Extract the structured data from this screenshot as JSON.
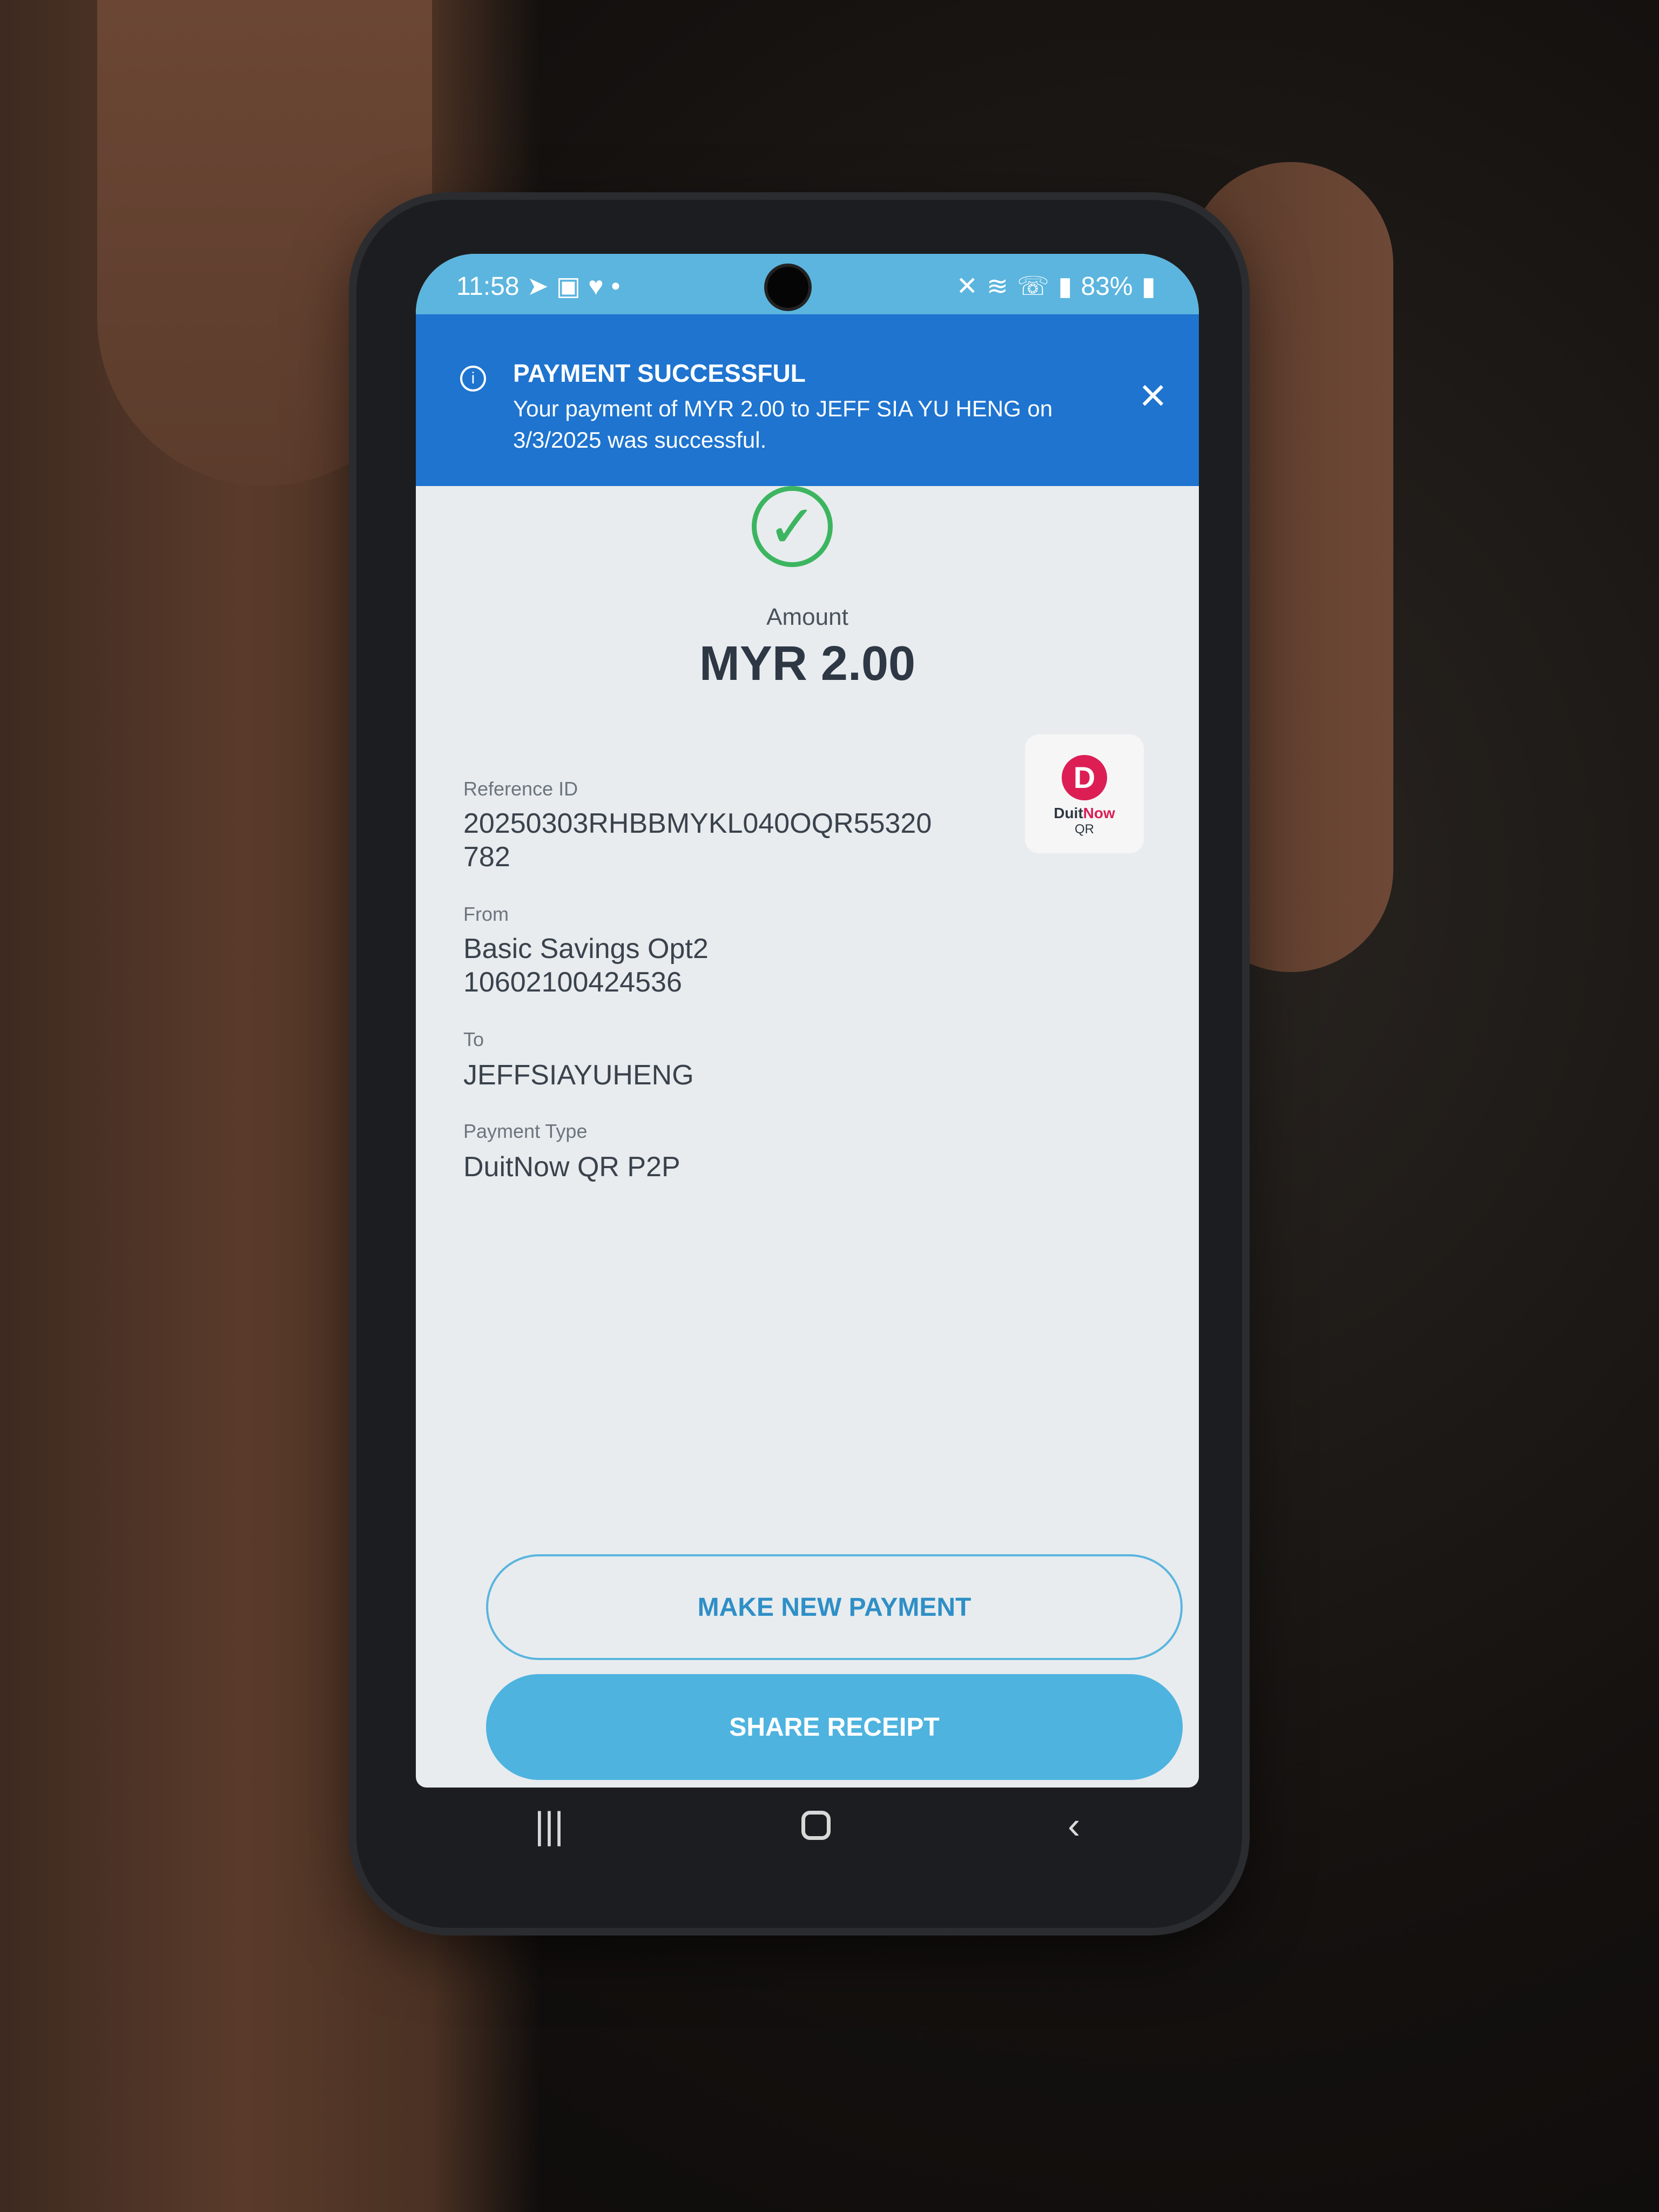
{
  "status_bar": {
    "time": "11:58",
    "battery": "83%"
  },
  "banner": {
    "title": "PAYMENT SUCCESSFUL",
    "message": "Your payment of MYR 2.00 to JEFF SIA YU HENG on 3/3/2025 was successful."
  },
  "amount": {
    "label": "Amount",
    "value": "MYR 2.00"
  },
  "details": {
    "reference_label": "Reference ID",
    "reference_value": "20250303RHBBMYKL040OQR55320 782",
    "from_label": "From",
    "from_account": "Basic Savings Opt2",
    "from_number": "10602100424536",
    "to_label": "To",
    "to_value": "JEFFSIAYUHENG",
    "payment_type_label": "Payment Type",
    "payment_type_value": "DuitNow QR P2P"
  },
  "duitnow_logo": {
    "mark": "D",
    "text_a": "Duit",
    "text_b": "Now",
    "qr": "QR"
  },
  "buttons": {
    "make_new_payment": "MAKE NEW PAYMENT",
    "share_receipt": "SHARE RECEIPT"
  },
  "colors": {
    "status_bar": "#5bb5de",
    "banner": "#1e74cf",
    "success_green": "#3db560",
    "primary_button": "#4eb3df",
    "duitnow_red": "#dc1e55"
  }
}
